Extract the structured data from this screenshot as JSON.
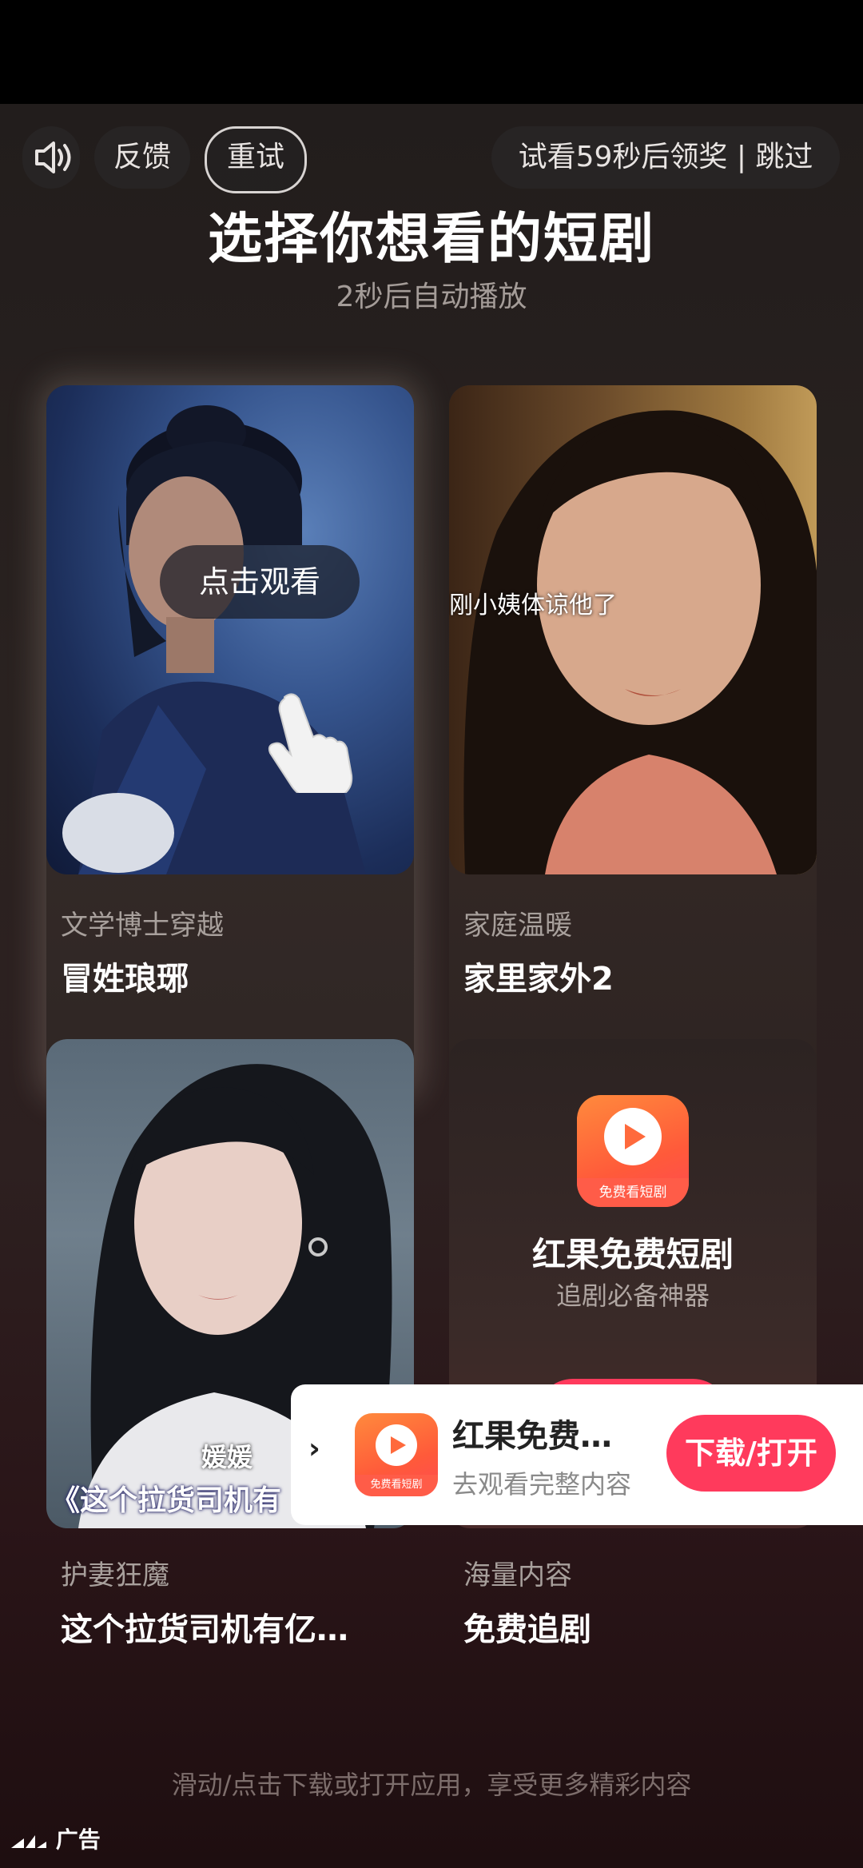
{
  "controls": {
    "feedback": "反馈",
    "retry": "重试",
    "skip_text": "试看59秒后领奖 | 跳过"
  },
  "header": {
    "title": "选择你想看的短剧",
    "subtitle": "2秒后自动播放"
  },
  "cards": [
    {
      "tag": "文学博士穿越",
      "title": "冒姓琅琊",
      "overlay": "点击观看"
    },
    {
      "tag": "家庭温暖",
      "title": "家里家外2",
      "caption": "刚小姨体谅他了"
    },
    {
      "tag": "护妻狂魔",
      "title": "这个拉货司机有亿…",
      "caption_name": "媛媛",
      "caption": "《这个拉货司机有"
    },
    {
      "tag": "海量内容",
      "title": "免费追剧",
      "app_name": "红果免费短剧",
      "app_slogan": "追剧必备神器"
    }
  ],
  "app_icon_label": "免费看短剧",
  "banner": {
    "app_name": "红果免费…",
    "description": "去观看完整内容",
    "button": "下载/打开"
  },
  "footer": {
    "hint": "滑动/点击下载或打开应用，享受更多精彩内容",
    "ad_label": "广告"
  },
  "colors": {
    "accent": "#ff3a5c",
    "app_icon": "#ff6a3c"
  }
}
